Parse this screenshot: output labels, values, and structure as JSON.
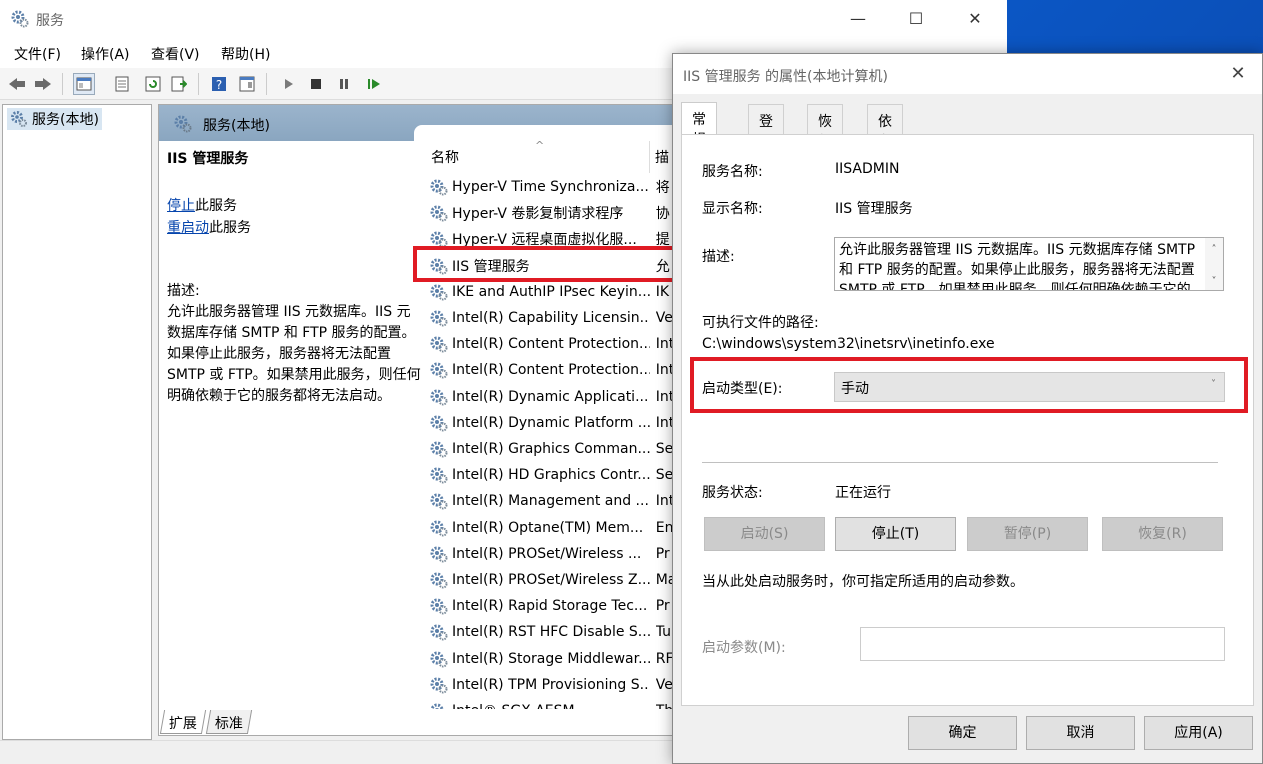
{
  "window": {
    "title": "服务"
  },
  "menu": [
    "文件(F)",
    "操作(A)",
    "查看(V)",
    "帮助(H)"
  ],
  "tree": {
    "root_label": "服务(本地)"
  },
  "detail": {
    "header_title": "服务(本地)",
    "service_name": "IIS 管理服务",
    "stop_link": "停止",
    "stop_suffix": "此服务",
    "restart_link": "重启动",
    "restart_suffix": "此服务",
    "desc_label": "描述:",
    "desc_text": "允许此服务器管理 IIS 元数据库。IIS 元数据库存储 SMTP 和 FTP 服务的配置。如果停止此服务，服务器将无法配置 SMTP 或 FTP。如果禁用此服务，则任何明确依赖于它的服务都将无法启动。"
  },
  "list": {
    "col_name": "名称",
    "col_desc": "描",
    "rows": [
      {
        "name": "Hyper-V Time Synchroniza...",
        "desc": "将"
      },
      {
        "name": "Hyper-V 卷影复制请求程序",
        "desc": "协"
      },
      {
        "name": "Hyper-V 远程桌面虚拟化服...",
        "desc": "提"
      },
      {
        "name": "IIS 管理服务",
        "desc": "允"
      },
      {
        "name": "IKE and AuthIP IPsec Keyin...",
        "desc": "IK"
      },
      {
        "name": "Intel(R) Capability Licensin...",
        "desc": "Ve"
      },
      {
        "name": "Intel(R) Content Protection...",
        "desc": "Int"
      },
      {
        "name": "Intel(R) Content Protection...",
        "desc": "Int"
      },
      {
        "name": "Intel(R) Dynamic Applicati...",
        "desc": "Int"
      },
      {
        "name": "Intel(R) Dynamic Platform ...",
        "desc": "Int"
      },
      {
        "name": "Intel(R) Graphics Comman...",
        "desc": "Se"
      },
      {
        "name": "Intel(R) HD Graphics Contr...",
        "desc": "Se"
      },
      {
        "name": "Intel(R) Management and ...",
        "desc": "Int"
      },
      {
        "name": "Intel(R) Optane(TM) Mem...",
        "desc": "En"
      },
      {
        "name": "Intel(R) PROSet/Wireless ...",
        "desc": "Pr"
      },
      {
        "name": "Intel(R) PROSet/Wireless Z...",
        "desc": "Ma"
      },
      {
        "name": "Intel(R) Rapid Storage Tec...",
        "desc": "Pr"
      },
      {
        "name": "Intel(R) RST HFC Disable S...",
        "desc": "Tu"
      },
      {
        "name": "Intel(R) Storage Middlewar...",
        "desc": "RF"
      },
      {
        "name": "Intel(R) TPM Provisioning S...",
        "desc": "Ve"
      },
      {
        "name": "Intel® SGX AESM",
        "desc": "Th"
      }
    ]
  },
  "bottom_tabs": [
    "扩展",
    "标准"
  ],
  "dialog": {
    "title": "IIS 管理服务 的属性(本地计算机)",
    "tabs": [
      "常规",
      "登录",
      "恢复",
      "依存关系"
    ],
    "service_name_label": "服务名称:",
    "service_name_value": "IISADMIN",
    "display_name_label": "显示名称:",
    "display_name_value": "IIS 管理服务",
    "description_label": "描述:",
    "description_value": "允许此服务器管理 IIS 元数据库。IIS 元数据库存储 SMTP 和 FTP 服务的配置。如果停止此服务，服务器将无法配置 SMTP 或 FTP。如果禁用此服务，则任何明确依赖于它的服务都将无法启动。",
    "exe_path_label": "可执行文件的路径:",
    "exe_path_value": "C:\\windows\\system32\\inetsrv\\inetinfo.exe",
    "startup_type_label": "启动类型(E):",
    "startup_type_value": "手动",
    "status_label": "服务状态:",
    "status_value": "正在运行",
    "btn_start": "启动(S)",
    "btn_stop": "停止(T)",
    "btn_pause": "暂停(P)",
    "btn_resume": "恢复(R)",
    "hint": "当从此处启动服务时，你可指定所适用的启动参数。",
    "param_label": "启动参数(M):",
    "param_value": "",
    "btn_ok": "确定",
    "btn_cancel": "取消",
    "btn_apply": "应用(A)"
  },
  "colors": {
    "highlight": "#e01b24",
    "link": "#0645ad",
    "header": "#9bb4cc"
  }
}
